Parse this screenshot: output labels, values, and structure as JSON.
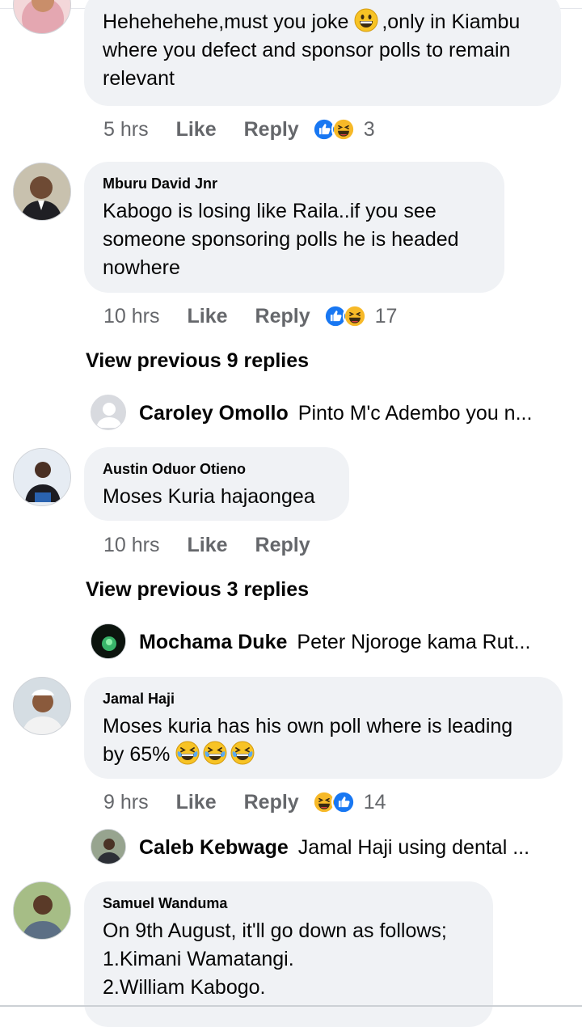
{
  "comments": [
    {
      "author": "",
      "lines": [
        "Hehehehehe,must you joke",
        ",only in Kiambu",
        "where you defect and sponsor polls to remain",
        "relevant"
      ],
      "time": "5 hrs",
      "like": "Like",
      "reply": "Reply",
      "reactions": [
        "like",
        "haha"
      ],
      "reaction_count": "3"
    },
    {
      "author": "Mburu David Jnr",
      "lines": [
        "Kabogo is losing like Raila..if you see",
        "someone sponsoring polls he is headed",
        "nowhere"
      ],
      "time": "10 hrs",
      "like": "Like",
      "reply": "Reply",
      "reactions": [
        "like",
        "haha"
      ],
      "reaction_count": "17"
    },
    {
      "author": "Austin Oduor Otieno",
      "lines": [
        "Moses Kuria hajaongea"
      ],
      "time": "10 hrs",
      "like": "Like",
      "reply": "Reply"
    },
    {
      "author": "Jamal Haji",
      "lines": [
        "Moses kuria has his own poll where is leading",
        "by 65%"
      ],
      "time": "9 hrs",
      "like": "Like",
      "reply": "Reply",
      "reactions": [
        "haha",
        "like"
      ],
      "reaction_count": "14"
    },
    {
      "author": "Samuel Wanduma",
      "lines": [
        "On 9th August, it'll go down as follows;",
        "1.Kimani Wamatangi.",
        "2.William Kabogo."
      ]
    }
  ],
  "view_previous": [
    "View previous 9 replies",
    "View previous 3 replies"
  ],
  "reply_previews": [
    {
      "name": "Caroley Omollo",
      "snippet": "Pinto M'c Adembo you n..."
    },
    {
      "name": "Mochama Duke",
      "snippet": "Peter Njoroge kama Rut..."
    },
    {
      "name": "Caleb Kebwage",
      "snippet": "Jamal Haji using dental ..."
    }
  ],
  "colors": {
    "bubble": "#f0f2f5",
    "meta_text": "#65676b",
    "like_blue": "#1877f2",
    "haha_yellow": "#f7b928"
  },
  "icons": {
    "like": "like-reaction-icon",
    "haha": "haha-reaction-icon",
    "grin": "grinning-emoji-icon",
    "laugh": "laughing-tears-emoji-icon"
  }
}
